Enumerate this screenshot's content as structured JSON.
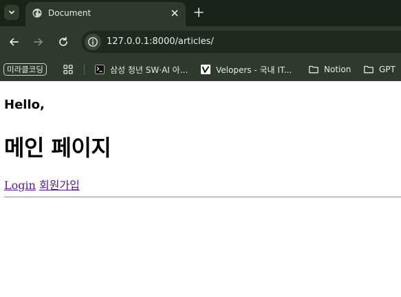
{
  "browser": {
    "tab": {
      "title": "Document"
    },
    "address_bar": {
      "url": "127.0.0.1:8000/articles/"
    },
    "bookmarks": [
      {
        "label": "미라클코딩",
        "icon": "none"
      },
      {
        "label": "",
        "icon": "apps-grid-icon"
      },
      {
        "label": "삼성 청년 SW·AI 아...",
        "icon": "terminal-icon"
      },
      {
        "label": "Velopers - 국내 IT...",
        "icon": "velopers-icon"
      },
      {
        "label": "Notion",
        "icon": "folder-icon"
      },
      {
        "label": "GPT",
        "icon": "folder-icon"
      }
    ]
  },
  "page": {
    "greeting": "Hello,",
    "title": "메인 페이지",
    "links": {
      "login": "Login",
      "signup": "회원가입"
    }
  }
}
